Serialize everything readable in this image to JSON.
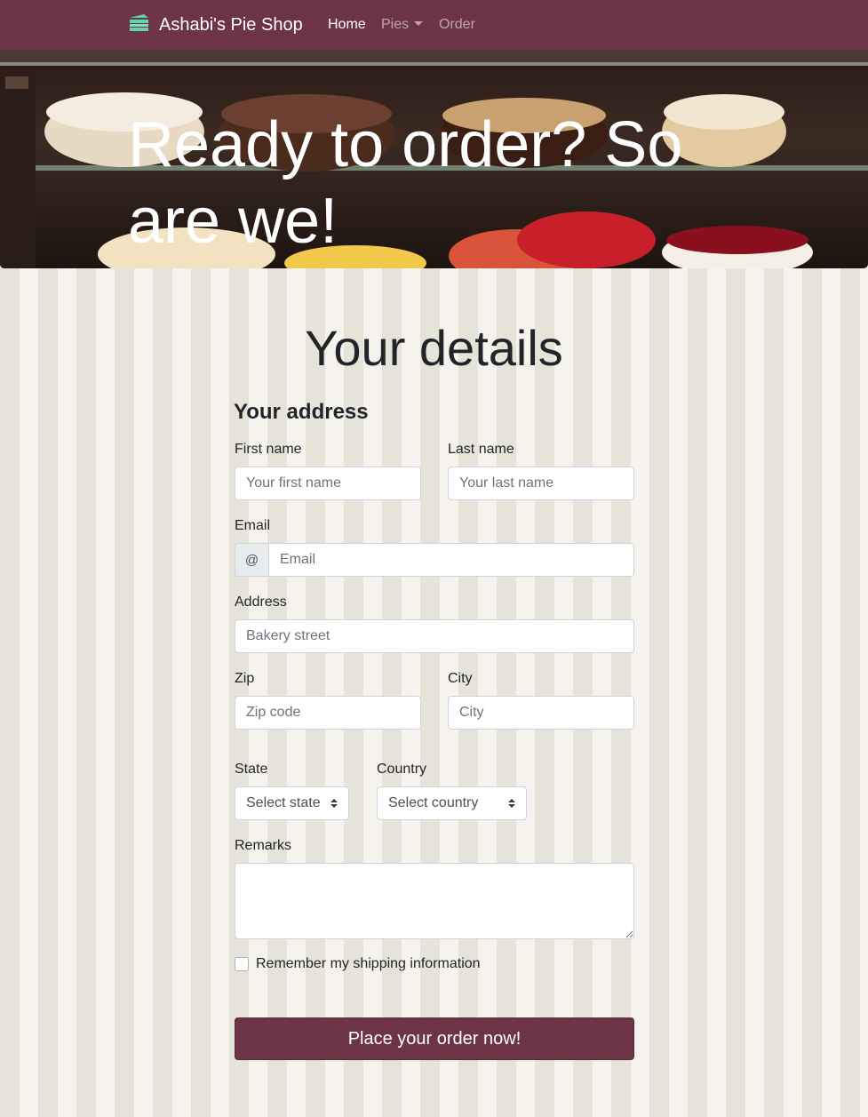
{
  "navbar": {
    "brand": "Ashabi's Pie Shop",
    "links": [
      {
        "label": "Home",
        "active": true
      },
      {
        "label": "Pies",
        "dropdown": true
      },
      {
        "label": "Order"
      }
    ],
    "background_color": "#6d3347",
    "logo_icon": "cake-icon",
    "logo_color": "#5fd6b0"
  },
  "hero": {
    "title": "Ready to order? So are we!"
  },
  "form": {
    "heading": "Your details",
    "section_title": "Your address",
    "fields": {
      "first_name": {
        "label": "First name",
        "placeholder": "Your first name"
      },
      "last_name": {
        "label": "Last name",
        "placeholder": "Your last name"
      },
      "email": {
        "label": "Email",
        "addon": "@",
        "placeholder": "Email"
      },
      "address": {
        "label": "Address",
        "placeholder": "Bakery street"
      },
      "zip": {
        "label": "Zip",
        "placeholder": "Zip code"
      },
      "city": {
        "label": "City",
        "placeholder": "City"
      },
      "state": {
        "label": "State",
        "selected": "Select state"
      },
      "country": {
        "label": "Country",
        "selected": "Select country"
      },
      "remarks": {
        "label": "Remarks"
      }
    },
    "remember_label": "Remember my shipping information",
    "submit_label": "Place your order now!",
    "accent_color": "#6d3347"
  }
}
